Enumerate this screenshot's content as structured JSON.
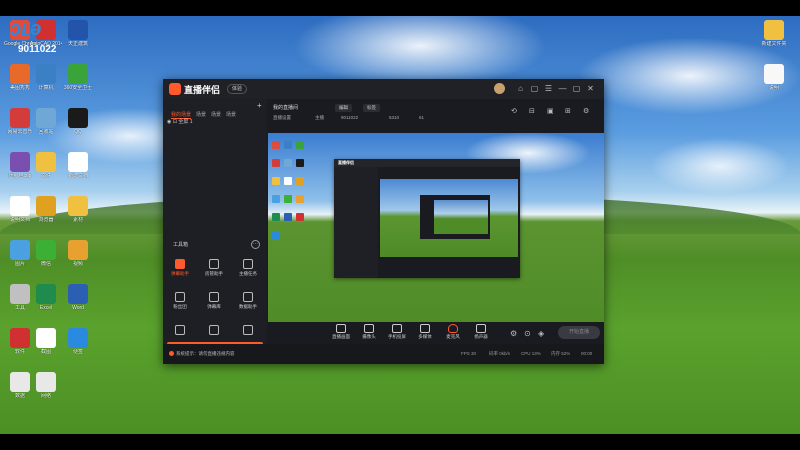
{
  "overlay": {
    "logo_mark": "ɔʟə",
    "room_id": "9011022"
  },
  "desktop_icons": [
    {
      "label": "Google Chrome",
      "color": "#e04b3c"
    },
    {
      "label": "AutoCAD 2014",
      "color": "#d13030"
    },
    {
      "label": "天正建筑",
      "color": "#2255aa"
    },
    {
      "label": "美图秀秀",
      "color": "#e86a2a"
    },
    {
      "label": "计算机",
      "color": "#3b7fc4"
    },
    {
      "label": "360安全卫士",
      "color": "#3aa43a"
    },
    {
      "label": "网易云音乐",
      "color": "#d43c3c"
    },
    {
      "label": "回收站",
      "color": "#6fa8d6"
    },
    {
      "label": "QQ",
      "color": "#1a1a1a"
    },
    {
      "label": "压缩包.zip",
      "color": "#7a4fb0"
    },
    {
      "label": "文件",
      "color": "#f0c040"
    },
    {
      "label": "新建文档",
      "color": "#ffffff"
    },
    {
      "label": "说明文档",
      "color": "#ffffff"
    },
    {
      "label": "浏览器",
      "color": "#e0a020"
    },
    {
      "label": "素材",
      "color": "#f0c040"
    },
    {
      "label": "图片",
      "color": "#4aa0e0"
    },
    {
      "label": "微信",
      "color": "#3cb034"
    },
    {
      "label": "视频",
      "color": "#e8a030"
    },
    {
      "label": "工具",
      "color": "#c0c0c0"
    },
    {
      "label": "Excel",
      "color": "#1f8b4c"
    },
    {
      "label": "Word",
      "color": "#2b5fb4"
    },
    {
      "label": "软件",
      "color": "#d03030"
    },
    {
      "label": "截图",
      "color": "#ffffff"
    },
    {
      "label": "便签",
      "color": "#2a8ae0"
    },
    {
      "label": "数据",
      "color": "#e8e8e8"
    },
    {
      "label": "网络",
      "color": "#e8e8e8"
    }
  ],
  "right_icons": [
    {
      "label": "新建文件夹",
      "color": "#f0c040"
    },
    {
      "label": "说明",
      "color": "#f8f8f8"
    }
  ],
  "app": {
    "brand": "直播伴侣",
    "version": "体验",
    "title_buttons": [
      "⌂",
      "▢",
      "☰",
      "—",
      "▢",
      "✕"
    ],
    "sidebar": {
      "tabs": [
        "我的场景",
        "场景",
        "场景",
        "场景"
      ],
      "add": "+",
      "scene": "◉  ⊡  全屏 1",
      "tools_title": "工具箱",
      "tools_more": "···",
      "tools": [
        {
          "label": "弹幕助手",
          "hot": true
        },
        {
          "label": "房管助手",
          "hot": false
        },
        {
          "label": "主播任务",
          "hot": false
        },
        {
          "label": "粉丝团",
          "hot": false
        },
        {
          "label": "弹幕库",
          "hot": false
        },
        {
          "label": "数据助手",
          "hot": false
        },
        {
          "label": "",
          "hot": false
        },
        {
          "label": "",
          "hot": false
        },
        {
          "label": "",
          "hot": false
        }
      ],
      "banner": "新人福利",
      "banner_close": "✕"
    },
    "info": {
      "title": "我的直播间",
      "pill1": "编辑",
      "pill2": "标签",
      "meta": [
        "直播设置",
        "主播",
        "9011022",
        "5310",
        "61"
      ]
    },
    "toolbar": [
      {
        "label": "直播画面"
      },
      {
        "label": "摄像头"
      },
      {
        "label": "手机投屏"
      },
      {
        "label": "多媒体"
      },
      {
        "label": "麦克风",
        "mic": true
      },
      {
        "label": "扬声器"
      }
    ],
    "toolbar_icons": [
      "⚙",
      "⊙",
      "◈"
    ],
    "live_button": "开始直播",
    "status": {
      "left": "系统提示：请勿直播违规内容",
      "stats": [
        "FPS 30",
        "码率 0kb/s",
        "CPU 13%",
        "内存 52%",
        "00:00"
      ]
    }
  }
}
